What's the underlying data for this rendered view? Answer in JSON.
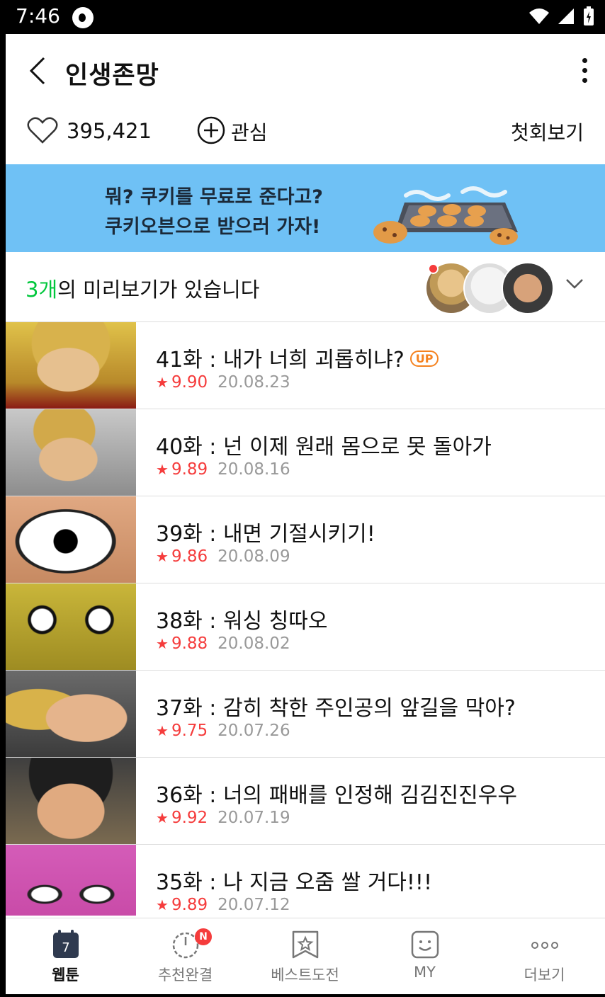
{
  "status": {
    "time": "7:46"
  },
  "header": {
    "title": "인생존망"
  },
  "actions": {
    "like_count": "395,421",
    "favorite_label": "관심",
    "first_episode_label": "첫회보기"
  },
  "banner": {
    "line1": "뭐? 쿠키를 무료로 준다고?",
    "line2": "쿠키오븐으로 받으러 가자!"
  },
  "preview": {
    "count": "3개",
    "text": "의 미리보기가 있습니다"
  },
  "episodes": [
    {
      "title": "41화 : 내가 너희 괴롭히냐?",
      "badge": "UP",
      "rating": "9.90",
      "date": "20.08.23"
    },
    {
      "title": "40화 : 넌 이제 원래 몸으로 못 돌아가",
      "rating": "9.89",
      "date": "20.08.16"
    },
    {
      "title": "39화 : 내면 기절시키기!",
      "rating": "9.86",
      "date": "20.08.09"
    },
    {
      "title": "38화 : 워싱 칭따오",
      "rating": "9.88",
      "date": "20.08.02"
    },
    {
      "title": "37화 : 감히 착한 주인공의 앞길을 막아?",
      "rating": "9.75",
      "date": "20.07.26"
    },
    {
      "title": "36화 : 너의 패배를 인정해 김김진진우우",
      "rating": "9.92",
      "date": "20.07.19"
    },
    {
      "title": "35화 : 나 지금 오줌 쌀 거다!!!",
      "rating": "9.89",
      "date": "20.07.12"
    }
  ],
  "tabs": [
    {
      "label": "웹툰",
      "icon": "calendar-icon",
      "icon_text": "7"
    },
    {
      "label": "추천완결",
      "icon": "timer-icon",
      "badge": "N"
    },
    {
      "label": "베스트도전",
      "icon": "star-bookmark-icon"
    },
    {
      "label": "MY",
      "icon": "smiley-icon"
    },
    {
      "label": "더보기",
      "icon": "more-dots-icon"
    }
  ],
  "colors": {
    "accent_green": "#00c73c",
    "rating_red": "#f53c3c",
    "up_orange": "#f5821f",
    "banner_blue": "#6fc1f5"
  }
}
